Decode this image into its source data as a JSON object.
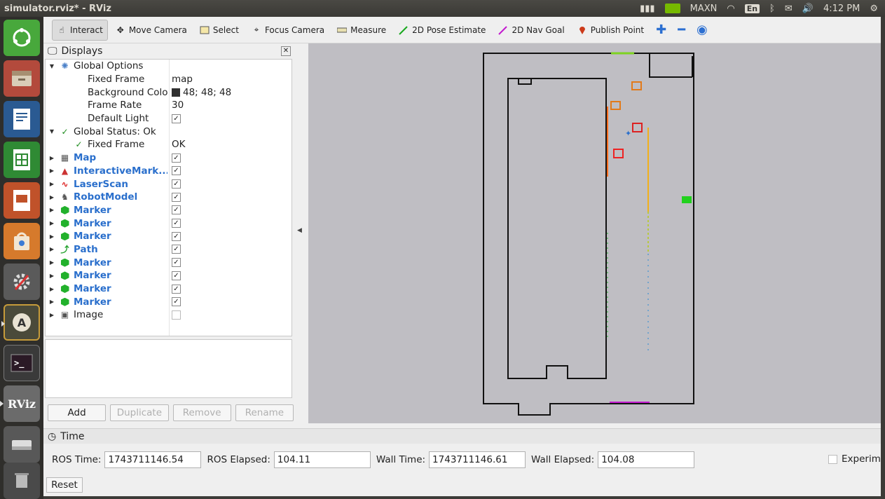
{
  "window_title": "simulator.rviz* - RViz",
  "topbar": {
    "indicators": [
      "MAXN",
      "En",
      "4:12 PM"
    ]
  },
  "launcher": {
    "apps": [
      "ubuntu-dash",
      "files",
      "writer",
      "calc",
      "impress",
      "software-center",
      "system-settings",
      "software-updater",
      "terminal",
      "rviz",
      "drive",
      "trash"
    ],
    "rviz_label": "RViz"
  },
  "toolbar": {
    "tools": [
      {
        "label": "Interact",
        "icon": "hand-icon",
        "active": true
      },
      {
        "label": "Move Camera",
        "icon": "move-icon"
      },
      {
        "label": "Select",
        "icon": "select-icon"
      },
      {
        "label": "Focus Camera",
        "icon": "focus-icon"
      },
      {
        "label": "Measure",
        "icon": "ruler-icon"
      },
      {
        "label": "2D Pose Estimate",
        "icon": "pose-arrow-icon",
        "color": "#18a81e"
      },
      {
        "label": "2D Nav Goal",
        "icon": "goal-arrow-icon",
        "color": "#c31bcf"
      },
      {
        "label": "Publish Point",
        "icon": "pin-icon",
        "color": "#cc3a1a"
      }
    ]
  },
  "displays": {
    "title": "Displays",
    "rows": [
      {
        "label": "Global Options",
        "value": "",
        "level": 0,
        "expanded": true,
        "icon": "globe-icon"
      },
      {
        "label": "Fixed Frame",
        "value": "map",
        "level": 1
      },
      {
        "label": "Background Color",
        "value": "48; 48; 48",
        "level": 1,
        "swatch": true
      },
      {
        "label": "Frame Rate",
        "value": "30",
        "level": 1
      },
      {
        "label": "Default Light",
        "value": "",
        "level": 1,
        "check": true
      },
      {
        "label": "Global Status: Ok",
        "value": "",
        "level": 0,
        "expanded": true,
        "icon": "check-icon"
      },
      {
        "label": "Fixed Frame",
        "value": "OK",
        "level": 1,
        "icon": "check-icon"
      },
      {
        "label": "Map",
        "level": 0,
        "blue": true,
        "check": true,
        "icon": "map-icon"
      },
      {
        "label": "InteractiveMark...",
        "level": 0,
        "blue": true,
        "check": true,
        "icon": "interactive-icon"
      },
      {
        "label": "LaserScan",
        "level": 0,
        "blue": true,
        "check": true,
        "icon": "laserscan-icon"
      },
      {
        "label": "RobotModel",
        "level": 0,
        "blue": true,
        "check": true,
        "icon": "robot-icon"
      },
      {
        "label": "Marker",
        "level": 0,
        "blue": true,
        "check": true,
        "icon": "marker-icon"
      },
      {
        "label": "Marker",
        "level": 0,
        "blue": true,
        "check": true,
        "icon": "marker-icon"
      },
      {
        "label": "Marker",
        "level": 0,
        "blue": true,
        "check": true,
        "icon": "marker-icon"
      },
      {
        "label": "Path",
        "level": 0,
        "blue": true,
        "check": true,
        "icon": "path-icon"
      },
      {
        "label": "Marker",
        "level": 0,
        "blue": true,
        "check": true,
        "icon": "marker-icon"
      },
      {
        "label": "Marker",
        "level": 0,
        "blue": true,
        "check": true,
        "icon": "marker-icon"
      },
      {
        "label": "Marker",
        "level": 0,
        "blue": true,
        "check": true,
        "icon": "marker-icon"
      },
      {
        "label": "Marker",
        "level": 0,
        "blue": true,
        "check": true,
        "icon": "marker-icon"
      },
      {
        "label": "Image",
        "level": 0,
        "blue": false,
        "check": false,
        "unchecked": true,
        "icon": "image-icon"
      }
    ],
    "buttons": {
      "add": "Add",
      "duplicate": "Duplicate",
      "remove": "Remove",
      "rename": "Rename"
    }
  },
  "time": {
    "title": "Time",
    "ros_time_label": "ROS Time:",
    "ros_time": "1743711146.54",
    "ros_elapsed_label": "ROS Elapsed:",
    "ros_elapsed": "104.11",
    "wall_time_label": "Wall Time:",
    "wall_time": "1743711146.61",
    "wall_elapsed_label": "Wall Elapsed:",
    "wall_elapsed": "104.08",
    "experimental_label": "Experim",
    "reset": "Reset"
  },
  "colors": {
    "viewport_bg": "#bfbec3",
    "accent_blue": "#2a6fcc",
    "marker_green": "#22b12c"
  }
}
